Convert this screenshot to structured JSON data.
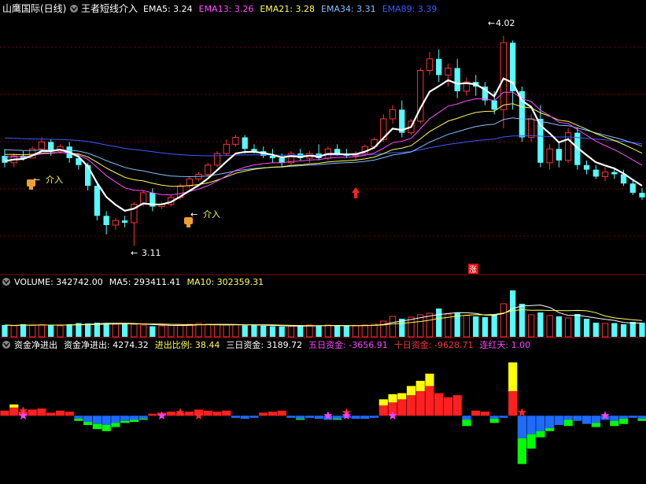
{
  "colors": {
    "up": "#ff3232",
    "down": "#54fcfc",
    "ema5": "#ffffff",
    "ema13": "#ff4dff",
    "ema21": "#ffff54",
    "ema34": "#80c0ff",
    "ema89": "#3b5bff",
    "ma5": "#ffffff",
    "ma10": "#ffff54",
    "fund_pos": "#ff2020",
    "fund_pos_extra": "#ffff00",
    "fund_neg": "#1e6bff",
    "fund_neg_extra": "#00ff00",
    "star_red": "#ff2a2a",
    "star_pink": "#ff40ff",
    "grid": "#7a0000"
  },
  "price_panel": {
    "title": "山鹰国际(日线)",
    "indicator": "王者短线介入",
    "legend": [
      {
        "label": "EMA5: 3.24",
        "color": "#ffffff"
      },
      {
        "label": "EMA13: 3.26",
        "color": "#ff4dff"
      },
      {
        "label": "EMA21: 3.28",
        "color": "#ffff54"
      },
      {
        "label": "EMA34: 3.31",
        "color": "#80c0ff"
      },
      {
        "label": "EMA89: 3.39",
        "color": "#3b5bff"
      }
    ],
    "high_label": "4.02",
    "low_label": "3.11",
    "signal_label": "介入",
    "zhang_label": "涨"
  },
  "volume_panel": {
    "legend": [
      {
        "label": "VOLUME: 342742.00",
        "color": "#ffffff"
      },
      {
        "label": "MA5: 293411.41",
        "color": "#ffffff"
      },
      {
        "label": "MA10: 302359.31",
        "color": "#ffff54"
      }
    ]
  },
  "fund_panel": {
    "legend": [
      {
        "label": "资金净进出",
        "color": "#ffffff"
      },
      {
        "label": "资金净进出: 4274.32",
        "color": "#ffffff"
      },
      {
        "label": "进出比例: 38.44",
        "color": "#ffff54"
      },
      {
        "label": "三日资金: 3189.72",
        "color": "#ffffff"
      },
      {
        "label": "五日资金: -3656.91",
        "color": "#ff40ff"
      },
      {
        "label": "十日资金: -9628.71",
        "color": "#ff3232"
      },
      {
        "label": "连红天: 1.00",
        "color": "#ff40ff"
      }
    ]
  },
  "chart_data": {
    "type": "candlestick",
    "n_candles": 70,
    "ohlc": [
      [
        3.5,
        3.53,
        3.45,
        3.47
      ],
      [
        3.47,
        3.51,
        3.45,
        3.5
      ],
      [
        3.5,
        3.52,
        3.48,
        3.49
      ],
      [
        3.49,
        3.54,
        3.49,
        3.53
      ],
      [
        3.53,
        3.58,
        3.52,
        3.56
      ],
      [
        3.56,
        3.57,
        3.5,
        3.52
      ],
      [
        3.52,
        3.55,
        3.51,
        3.54
      ],
      [
        3.54,
        3.56,
        3.47,
        3.49
      ],
      [
        3.49,
        3.51,
        3.44,
        3.46
      ],
      [
        3.46,
        3.47,
        3.35,
        3.37
      ],
      [
        3.37,
        3.39,
        3.22,
        3.24
      ],
      [
        3.24,
        3.26,
        3.16,
        3.2
      ],
      [
        3.2,
        3.23,
        3.18,
        3.22
      ],
      [
        3.22,
        3.24,
        3.19,
        3.21
      ],
      [
        3.21,
        3.3,
        3.11,
        3.29
      ],
      [
        3.29,
        3.35,
        3.28,
        3.34
      ],
      [
        3.34,
        3.36,
        3.26,
        3.28
      ],
      [
        3.28,
        3.3,
        3.27,
        3.29
      ],
      [
        3.29,
        3.33,
        3.28,
        3.32
      ],
      [
        3.32,
        3.38,
        3.31,
        3.37
      ],
      [
        3.37,
        3.41,
        3.36,
        3.4
      ],
      [
        3.4,
        3.43,
        3.39,
        3.42
      ],
      [
        3.42,
        3.47,
        3.41,
        3.46
      ],
      [
        3.46,
        3.52,
        3.45,
        3.51
      ],
      [
        3.51,
        3.57,
        3.5,
        3.55
      ],
      [
        3.55,
        3.59,
        3.54,
        3.58
      ],
      [
        3.58,
        3.59,
        3.51,
        3.53
      ],
      [
        3.53,
        3.55,
        3.51,
        3.52
      ],
      [
        3.52,
        3.54,
        3.49,
        3.5
      ],
      [
        3.5,
        3.53,
        3.47,
        3.49
      ],
      [
        3.49,
        3.51,
        3.45,
        3.47
      ],
      [
        3.47,
        3.52,
        3.46,
        3.51
      ],
      [
        3.51,
        3.53,
        3.48,
        3.49
      ],
      [
        3.49,
        3.52,
        3.47,
        3.51
      ],
      [
        3.51,
        3.55,
        3.48,
        3.49
      ],
      [
        3.49,
        3.54,
        3.48,
        3.53
      ],
      [
        3.53,
        3.55,
        3.5,
        3.51
      ],
      [
        3.51,
        3.53,
        3.49,
        3.5
      ],
      [
        3.5,
        3.52,
        3.48,
        3.51
      ],
      [
        3.51,
        3.55,
        3.5,
        3.54
      ],
      [
        3.54,
        3.58,
        3.53,
        3.57
      ],
      [
        3.57,
        3.68,
        3.56,
        3.66
      ],
      [
        3.66,
        3.72,
        3.64,
        3.7
      ],
      [
        3.7,
        3.74,
        3.58,
        3.6
      ],
      [
        3.6,
        3.66,
        3.59,
        3.65
      ],
      [
        3.65,
        3.88,
        3.64,
        3.87
      ],
      [
        3.87,
        3.95,
        3.85,
        3.92
      ],
      [
        3.92,
        3.96,
        3.82,
        3.85
      ],
      [
        3.85,
        3.9,
        3.8,
        3.88
      ],
      [
        3.88,
        3.92,
        3.75,
        3.78
      ],
      [
        3.78,
        3.84,
        3.76,
        3.82
      ],
      [
        3.82,
        3.85,
        3.76,
        3.8
      ],
      [
        3.8,
        3.82,
        3.72,
        3.74
      ],
      [
        3.74,
        3.78,
        3.68,
        3.7
      ],
      [
        3.7,
        4.02,
        3.62,
        3.99
      ],
      [
        3.99,
        4.0,
        3.7,
        3.78
      ],
      [
        3.78,
        3.8,
        3.56,
        3.58
      ],
      [
        3.58,
        3.68,
        3.56,
        3.66
      ],
      [
        3.66,
        3.72,
        3.45,
        3.47
      ],
      [
        3.47,
        3.55,
        3.44,
        3.53
      ],
      [
        3.53,
        3.56,
        3.45,
        3.48
      ],
      [
        3.48,
        3.62,
        3.47,
        3.6
      ],
      [
        3.6,
        3.62,
        3.44,
        3.46
      ],
      [
        3.46,
        3.48,
        3.42,
        3.44
      ],
      [
        3.44,
        3.46,
        3.4,
        3.41
      ],
      [
        3.41,
        3.45,
        3.39,
        3.43
      ],
      [
        3.43,
        3.45,
        3.4,
        3.42
      ],
      [
        3.42,
        3.44,
        3.37,
        3.38
      ],
      [
        3.38,
        3.4,
        3.33,
        3.34
      ],
      [
        3.34,
        3.36,
        3.31,
        3.32
      ]
    ],
    "volume": [
      150000,
      140000,
      160000,
      145000,
      155000,
      150000,
      140000,
      160000,
      175000,
      170000,
      180000,
      175000,
      165000,
      170000,
      160000,
      150000,
      135000,
      140000,
      145000,
      150000,
      160000,
      170000,
      160000,
      155000,
      150000,
      155000,
      145000,
      150000,
      140000,
      135000,
      130000,
      135000,
      140000,
      150000,
      145000,
      150000,
      140000,
      135000,
      145000,
      150000,
      160000,
      200000,
      260000,
      230000,
      250000,
      280000,
      300000,
      360000,
      290000,
      310000,
      270000,
      260000,
      250000,
      280000,
      420000,
      590000,
      420000,
      280000,
      310000,
      270000,
      260000,
      240000,
      290000,
      230000,
      180000,
      170000,
      175000,
      160000,
      190000,
      180000
    ],
    "fund_net": [
      5,
      8,
      4,
      6,
      7,
      3,
      5,
      4,
      -3,
      -6,
      -8,
      -9,
      -7,
      -5,
      -4,
      -3,
      2,
      3,
      4,
      3,
      4,
      6,
      5,
      4,
      5,
      -2,
      -3,
      -2,
      3,
      4,
      5,
      -2,
      -3,
      -2,
      -3,
      -4,
      -3,
      -2,
      -3,
      -3,
      -2,
      10,
      13,
      16,
      20,
      24,
      29,
      22,
      18,
      20,
      -4,
      5,
      4,
      -3,
      -2,
      24,
      -22,
      -18,
      -15,
      -12,
      -9,
      -4,
      -5,
      -8,
      -7,
      -4,
      -5,
      -3,
      -2,
      -3
    ],
    "fund_extra": [
      0,
      3,
      0,
      0,
      0,
      0,
      0,
      0,
      -2,
      -3,
      -5,
      -6,
      -4,
      -2,
      -2,
      -1,
      0,
      0,
      0,
      0,
      0,
      0,
      0,
      0,
      0,
      0,
      0,
      0,
      0,
      0,
      0,
      0,
      -1,
      0,
      0,
      0,
      -1,
      0,
      0,
      0,
      0,
      6,
      8,
      6,
      9,
      10,
      12,
      0,
      0,
      0,
      -6,
      0,
      0,
      -4,
      0,
      28,
      -25,
      -14,
      -6,
      -3,
      0,
      -6,
      0,
      0,
      -4,
      0,
      -5,
      -5,
      0,
      -2
    ],
    "price_ylim": [
      3.05,
      4.1
    ],
    "volume_ylim": [
      0,
      620000
    ],
    "fund_ylim": [
      -55,
      60
    ]
  }
}
